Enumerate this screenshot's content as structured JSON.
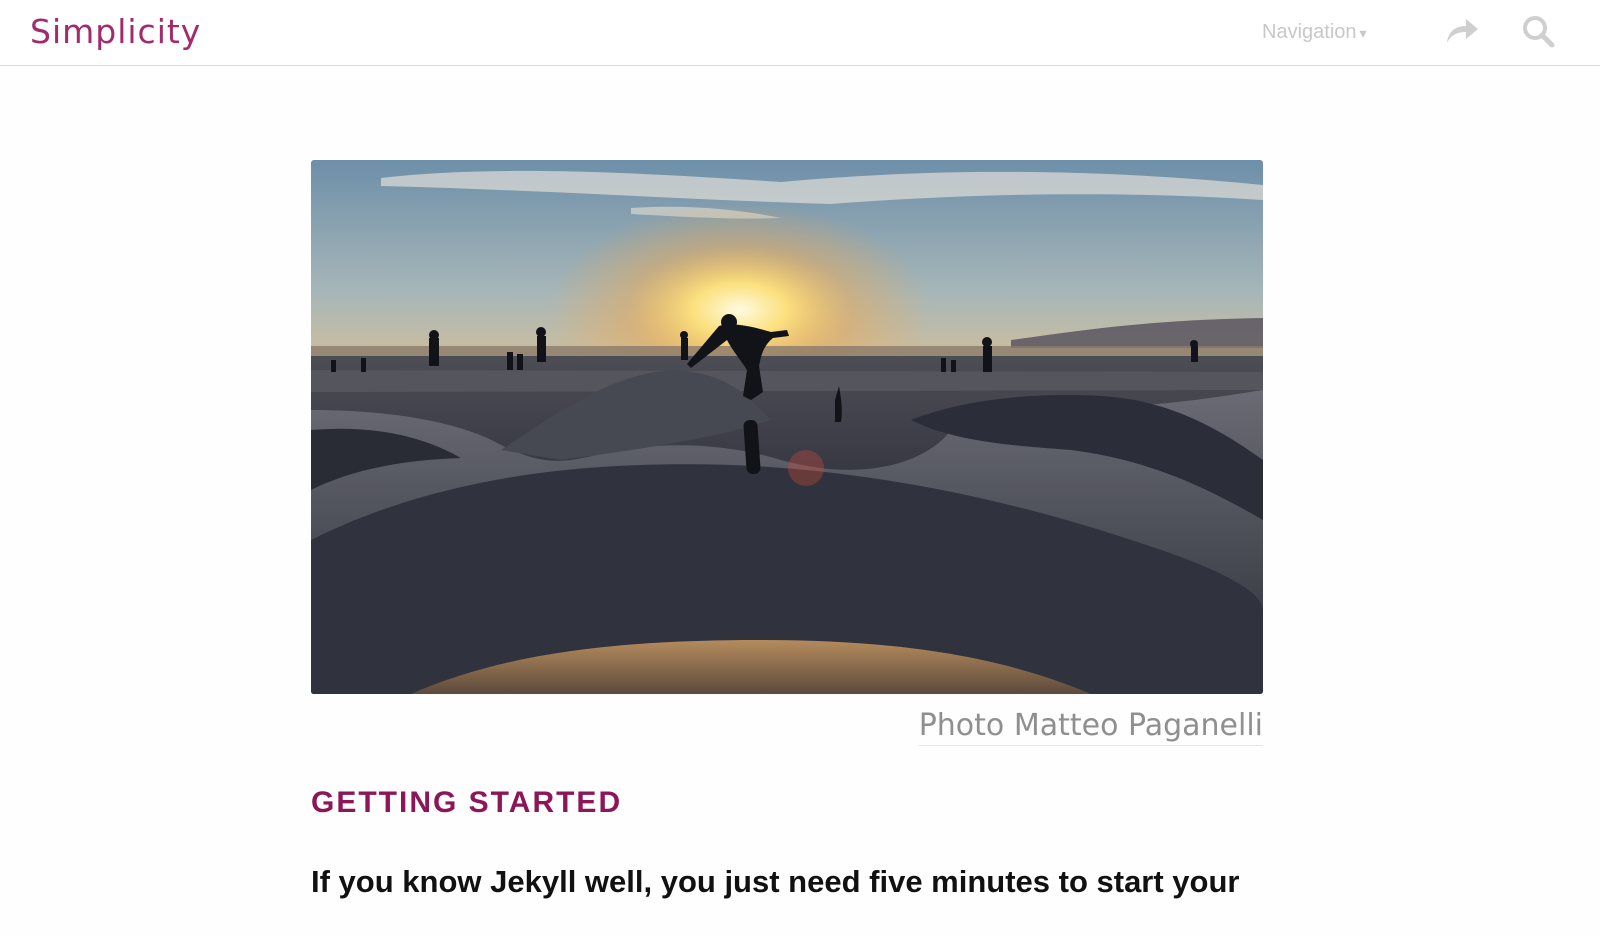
{
  "header": {
    "site_title": "Simplicity",
    "nav_label": "Navigation",
    "nav_caret": "▾",
    "share_icon": "share-arrow-icon",
    "search_icon": "search-icon"
  },
  "article": {
    "image_alt": "Skateboarder silhouetted against the sunset at a skatepark",
    "image_caption": "Photo Matteo Paganelli",
    "section_heading": "GETTING STARTED",
    "lead_text": "If you know Jekyll well, you just need five minutes to start your"
  },
  "colors": {
    "brand": "#a32a6b",
    "heading": "#8c1657",
    "nav_muted": "#c8c8c8",
    "caption": "#8f8f8f"
  }
}
